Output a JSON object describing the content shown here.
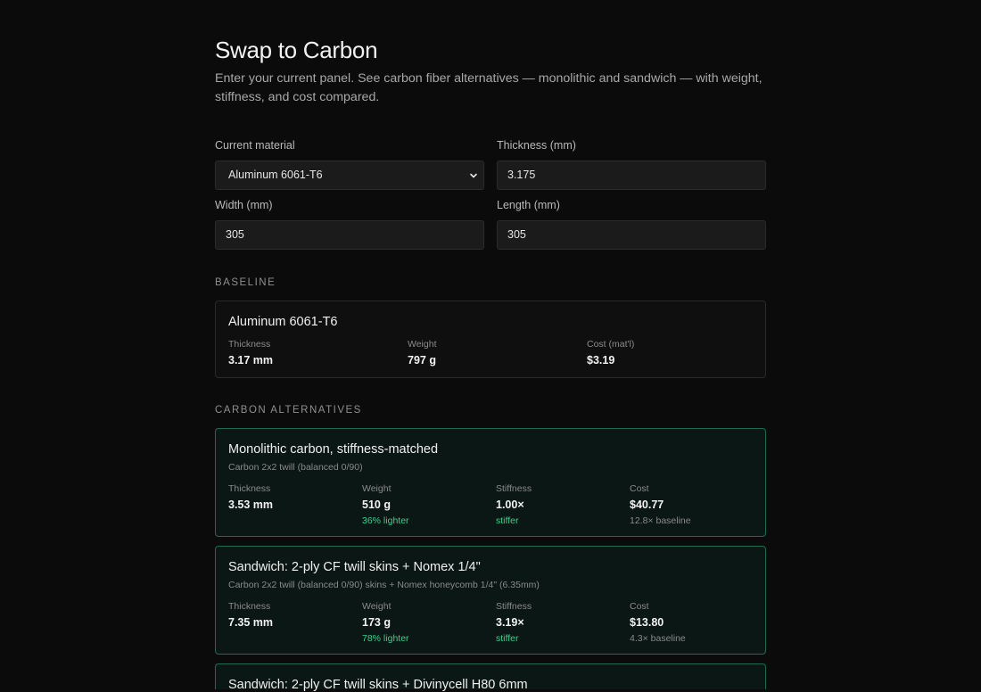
{
  "header": {
    "title": "Swap to Carbon",
    "subtitle": "Enter your current panel. See carbon fiber alternatives — monolithic and sandwich — with weight, stiffness, and cost compared."
  },
  "form": {
    "material": {
      "label": "Current material",
      "value": "Aluminum 6061-T6"
    },
    "thickness": {
      "label": "Thickness (mm)",
      "value": "3.175"
    },
    "width": {
      "label": "Width (mm)",
      "value": "305"
    },
    "length": {
      "label": "Length (mm)",
      "value": "305"
    }
  },
  "baseline": {
    "section_label": "BASELINE",
    "name": "Aluminum 6061-T6",
    "thickness": {
      "label": "Thickness",
      "value": "3.17 mm"
    },
    "weight": {
      "label": "Weight",
      "value": "797 g"
    },
    "cost": {
      "label": "Cost (mat'l)",
      "value": "$3.19"
    }
  },
  "alternatives": {
    "section_label": "CARBON ALTERNATIVES",
    "items": [
      {
        "title": "Monolithic carbon, stiffness-matched",
        "subtitle": "Carbon 2x2 twill (balanced 0/90)",
        "thickness": {
          "label": "Thickness",
          "value": "3.53 mm"
        },
        "weight": {
          "label": "Weight",
          "value": "510 g",
          "note": "36% lighter"
        },
        "stiffness": {
          "label": "Stiffness",
          "value": "1.00×",
          "note": "stiffer"
        },
        "cost": {
          "label": "Cost",
          "value": "$40.77",
          "note": "12.8× baseline"
        }
      },
      {
        "title": "Sandwich: 2-ply CF twill skins + Nomex 1/4\"",
        "subtitle": "Carbon 2x2 twill (balanced 0/90) skins + Nomex honeycomb 1/4\" (6.35mm)",
        "thickness": {
          "label": "Thickness",
          "value": "7.35 mm"
        },
        "weight": {
          "label": "Weight",
          "value": "173 g",
          "note": "78% lighter"
        },
        "stiffness": {
          "label": "Stiffness",
          "value": "3.19×",
          "note": "stiffer"
        },
        "cost": {
          "label": "Cost",
          "value": "$13.80",
          "note": "4.3× baseline"
        }
      },
      {
        "title": "Sandwich: 2-ply CF twill skins + Divinycell H80 6mm"
      }
    ]
  },
  "colors": {
    "background": "#0b0b0b",
    "accent_green": "#3ecf8e",
    "card_border_green": "#1f6b52"
  }
}
